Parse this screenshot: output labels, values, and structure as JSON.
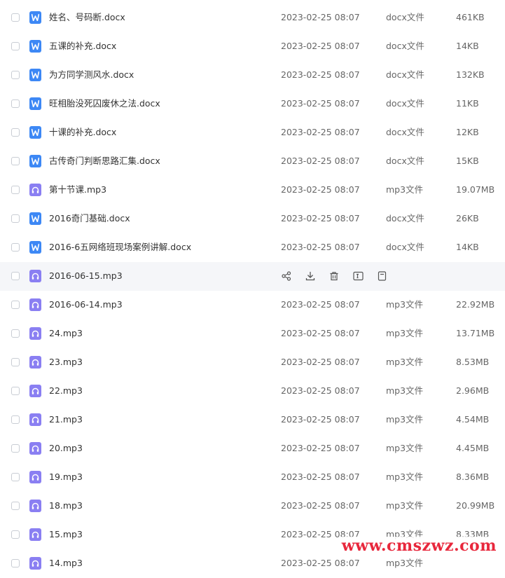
{
  "files": [
    {
      "name": "姓名、号码断.docx",
      "icon": "doc",
      "date": "2023-02-25 08:07",
      "type": "docx文件",
      "size": "461KB"
    },
    {
      "name": "五课的补充.docx",
      "icon": "doc",
      "date": "2023-02-25 08:07",
      "type": "docx文件",
      "size": "14KB"
    },
    {
      "name": "为方同学测风水.docx",
      "icon": "doc",
      "date": "2023-02-25 08:07",
      "type": "docx文件",
      "size": "132KB"
    },
    {
      "name": "旺相胎没死囚废休之法.docx",
      "icon": "doc",
      "date": "2023-02-25 08:07",
      "type": "docx文件",
      "size": "11KB"
    },
    {
      "name": "十课的补充.docx",
      "icon": "doc",
      "date": "2023-02-25 08:07",
      "type": "docx文件",
      "size": "12KB"
    },
    {
      "name": "古传奇门判断思路汇集.docx",
      "icon": "doc",
      "date": "2023-02-25 08:07",
      "type": "docx文件",
      "size": "15KB"
    },
    {
      "name": "第十节课.mp3",
      "icon": "audio",
      "date": "2023-02-25 08:07",
      "type": "mp3文件",
      "size": "19.07MB"
    },
    {
      "name": "2016奇门基础.docx",
      "icon": "doc",
      "date": "2023-02-25 08:07",
      "type": "docx文件",
      "size": "26KB"
    },
    {
      "name": "2016-6五网络班现场案例讲解.docx",
      "icon": "doc",
      "date": "2023-02-25 08:07",
      "type": "docx文件",
      "size": "14KB"
    },
    {
      "name": "2016-06-15.mp3",
      "icon": "audio",
      "date": "",
      "type": "",
      "size": "",
      "hover": true
    },
    {
      "name": "2016-06-14.mp3",
      "icon": "audio",
      "date": "2023-02-25 08:07",
      "type": "mp3文件",
      "size": "22.92MB"
    },
    {
      "name": "24.mp3",
      "icon": "audio",
      "date": "2023-02-25 08:07",
      "type": "mp3文件",
      "size": "13.71MB"
    },
    {
      "name": "23.mp3",
      "icon": "audio",
      "date": "2023-02-25 08:07",
      "type": "mp3文件",
      "size": "8.53MB"
    },
    {
      "name": "22.mp3",
      "icon": "audio",
      "date": "2023-02-25 08:07",
      "type": "mp3文件",
      "size": "2.96MB"
    },
    {
      "name": "21.mp3",
      "icon": "audio",
      "date": "2023-02-25 08:07",
      "type": "mp3文件",
      "size": "4.54MB"
    },
    {
      "name": "20.mp3",
      "icon": "audio",
      "date": "2023-02-25 08:07",
      "type": "mp3文件",
      "size": "4.45MB"
    },
    {
      "name": "19.mp3",
      "icon": "audio",
      "date": "2023-02-25 08:07",
      "type": "mp3文件",
      "size": "8.36MB"
    },
    {
      "name": "18.mp3",
      "icon": "audio",
      "date": "2023-02-25 08:07",
      "type": "mp3文件",
      "size": "20.99MB"
    },
    {
      "name": "15.mp3",
      "icon": "audio",
      "date": "2023-02-25 08:07",
      "type": "mp3文件",
      "size": "8.33MB"
    },
    {
      "name": "14.mp3",
      "icon": "audio",
      "date": "2023-02-25 08:07",
      "type": "mp3文件",
      "size": ""
    }
  ],
  "hover_actions": [
    "share-icon",
    "download-icon",
    "delete-icon",
    "rename-icon",
    "more-icon"
  ],
  "watermark": "www.cmszwz.com",
  "colors": {
    "doc_icon": "#3d88f5",
    "audio_icon": "#8a7ff2",
    "hover_row": "#f5f6f9",
    "watermark": "#e8273c"
  }
}
